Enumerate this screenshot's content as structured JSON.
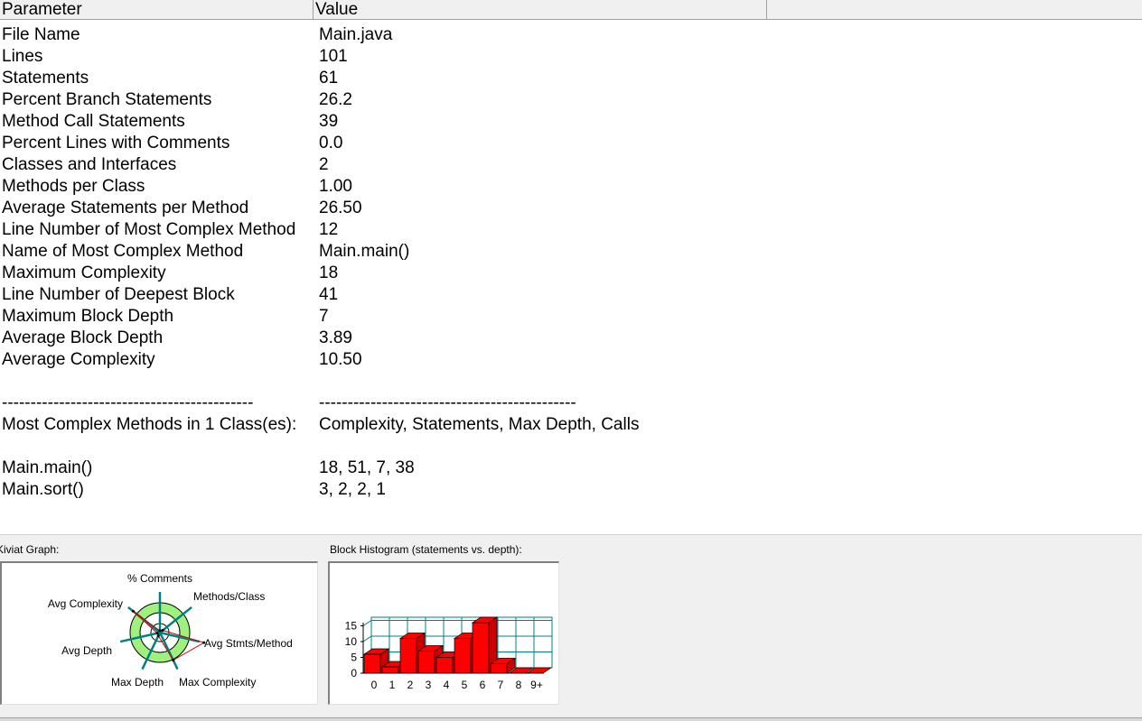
{
  "header": {
    "param_label": "Parameter",
    "value_label": "Value"
  },
  "rows": [
    {
      "param": "File Name",
      "value": "Main.java"
    },
    {
      "param": "Lines",
      "value": "101"
    },
    {
      "param": "Statements",
      "value": "61"
    },
    {
      "param": "Percent Branch Statements",
      "value": "26.2"
    },
    {
      "param": "Method Call Statements",
      "value": "39"
    },
    {
      "param": "Percent Lines with Comments",
      "value": "0.0"
    },
    {
      "param": "Classes and Interfaces",
      "value": "2"
    },
    {
      "param": "Methods per Class",
      "value": "1.00"
    },
    {
      "param": "Average Statements per Method",
      "value": "26.50"
    },
    {
      "param": "Line Number of Most Complex Method",
      "value": "12"
    },
    {
      "param": "Name of Most Complex Method",
      "value": "Main.main()"
    },
    {
      "param": "Maximum Complexity",
      "value": "18"
    },
    {
      "param": "Line Number of Deepest Block",
      "value": "41"
    },
    {
      "param": "Maximum Block Depth",
      "value": "7"
    },
    {
      "param": "Average Block Depth",
      "value": "3.89"
    },
    {
      "param": "Average Complexity",
      "value": "10.50"
    },
    {
      "param": "",
      "value": ""
    },
    {
      "param": "--------------------------------------------",
      "value": "---------------------------------------------"
    },
    {
      "param": "Most Complex Methods in 1 Class(es):",
      "value": "Complexity, Statements, Max Depth, Calls"
    },
    {
      "param": "",
      "value": ""
    },
    {
      "param": "Main.main()",
      "value": "18, 51, 7, 38"
    },
    {
      "param": "Main.sort()",
      "value": "3, 2, 2, 1"
    }
  ],
  "kiviat": {
    "label": "Kiviat Graph:",
    "axes": [
      "% Comments",
      "Methods/Class",
      "Avg Stmts/Method",
      "Max Complexity",
      "Max Depth",
      "Avg Depth",
      "Avg Complexity"
    ]
  },
  "histogram": {
    "label": "Block Histogram (statements vs. depth):",
    "y_ticks": [
      "0",
      "5",
      "10",
      "15"
    ]
  },
  "chart_data": {
    "type": "bar",
    "categories": [
      "0",
      "1",
      "2",
      "3",
      "4",
      "5",
      "6",
      "7",
      "8",
      "9+"
    ],
    "values": [
      6,
      2,
      11,
      7,
      5,
      11,
      16,
      3,
      0,
      0
    ],
    "ylim": [
      0,
      16
    ],
    "grid": true,
    "color": "#ff0000"
  },
  "colors": {
    "bar": "#ff0000",
    "grid": "#008080",
    "ring": "#a0f080",
    "kiviat_line": "#cc0000"
  }
}
